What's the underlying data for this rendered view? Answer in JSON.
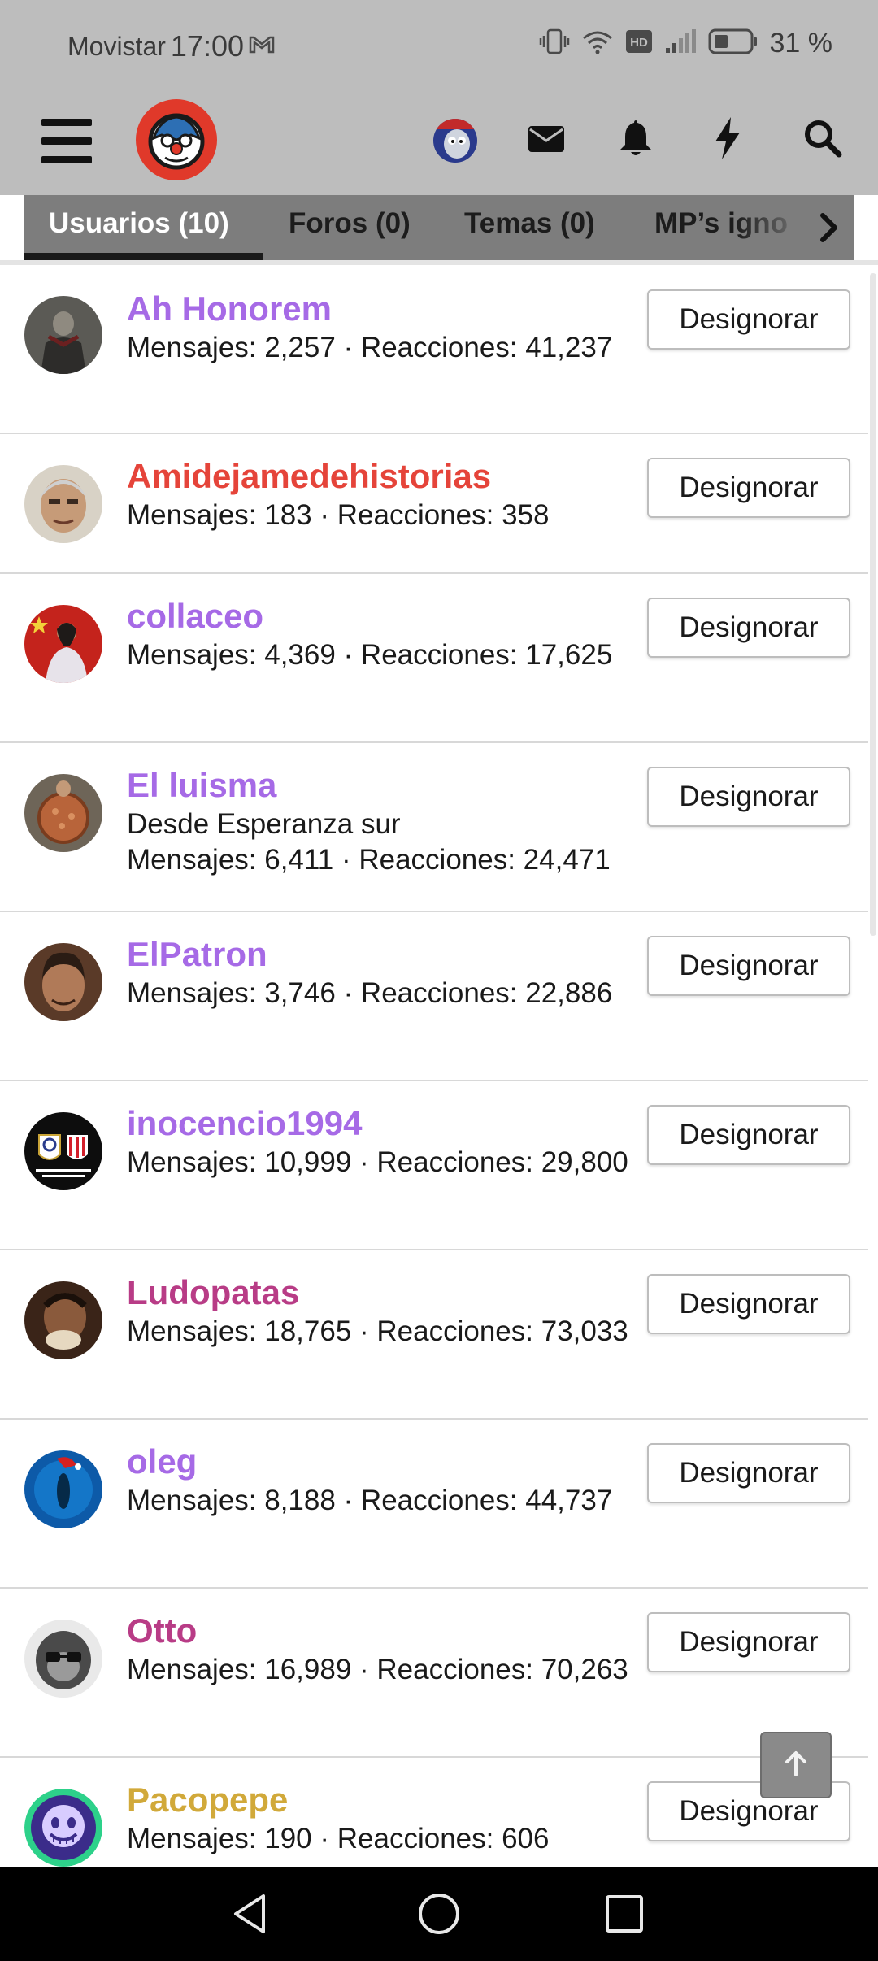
{
  "status_bar": {
    "carrier": "Movistar",
    "time": "17:00",
    "battery_pct": "31 %"
  },
  "header": {
    "icons": [
      "menu-icon",
      "site-logo",
      "user-avatar",
      "mail-icon",
      "bell-icon",
      "bolt-icon",
      "search-icon"
    ]
  },
  "tabs": [
    {
      "label": "Usuarios (10)",
      "active": true
    },
    {
      "label": "Foros (0)",
      "active": false
    },
    {
      "label": "Temas (0)",
      "active": false
    },
    {
      "label": "MP’s igno",
      "active": false
    }
  ],
  "users": [
    {
      "name": "Ah Honorem",
      "color": "#a66ae6",
      "info": "",
      "meta": "Mensajes: 2,257 · Reacciones: 41,237",
      "button": "Designorar"
    },
    {
      "name": "Amidejamedehistorias",
      "color": "#e5443a",
      "info": "",
      "meta": "Mensajes: 183 · Reacciones: 358",
      "button": "Designorar"
    },
    {
      "name": "collaceo",
      "color": "#a66ae6",
      "info": "",
      "meta": "Mensajes: 4,369 · Reacciones: 17,625",
      "button": "Designorar"
    },
    {
      "name": "El luisma",
      "color": "#a66ae6",
      "info": "Desde Esperanza sur",
      "meta": "Mensajes: 6,411 · Reacciones: 24,471",
      "button": "Designorar"
    },
    {
      "name": "ElPatron",
      "color": "#a66ae6",
      "info": "",
      "meta": "Mensajes: 3,746 · Reacciones: 22,886",
      "button": "Designorar"
    },
    {
      "name": "inocencio1994",
      "color": "#a66ae6",
      "info": "",
      "meta": "Mensajes: 10,999 · Reacciones: 29,800",
      "button": "Designorar"
    },
    {
      "name": "Ludopatas",
      "color": "#b83c86",
      "info": "",
      "meta": "Mensajes: 18,765 · Reacciones: 73,033",
      "button": "Designorar"
    },
    {
      "name": "oleg",
      "color": "#a66ae6",
      "info": "",
      "meta": "Mensajes: 8,188 · Reacciones: 44,737",
      "button": "Designorar"
    },
    {
      "name": "Otto",
      "color": "#b83c86",
      "info": "",
      "meta": "Mensajes: 16,989 · Reacciones: 70,263",
      "button": "Designorar"
    },
    {
      "name": "Pacopepe",
      "color": "#d1a93a",
      "info": "",
      "meta": "Mensajes: 190 · Reacciones: 606",
      "button": "Designorar"
    }
  ],
  "navbar": {
    "icons": [
      "back-icon",
      "home-icon",
      "recents-icon"
    ]
  }
}
